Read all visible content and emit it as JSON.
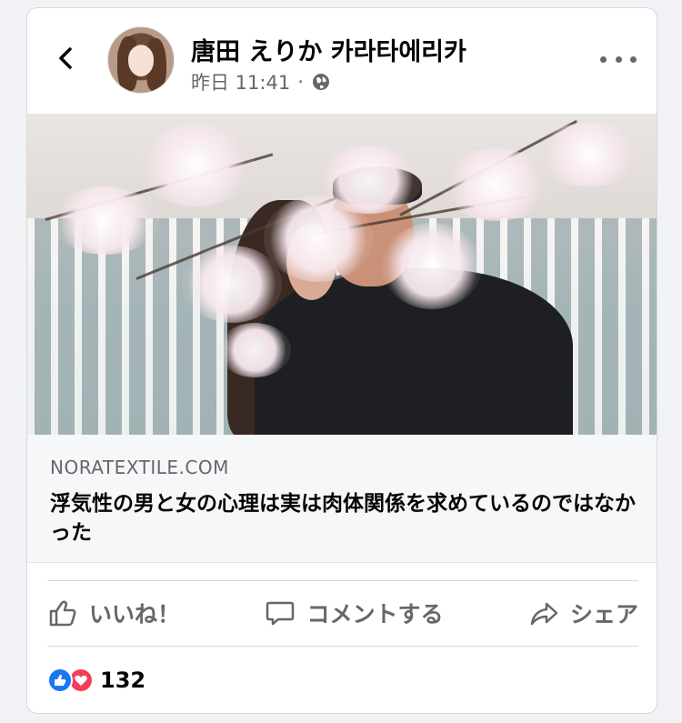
{
  "header": {
    "author": "唐田 えりか 카라타에리카",
    "timestamp": "昨日 11:41",
    "separator": "·",
    "privacy_icon": "globe-icon",
    "back_icon": "chevron-left-icon",
    "more_icon": "more-horizontal-icon"
  },
  "link": {
    "domain": "NORATEXTILE.COM",
    "headline": "浮気性の男と女の心理は実は肉体関係を求めているのではなかった"
  },
  "actions": [
    {
      "label": "いいね！",
      "icon": "thumbs-up-icon"
    },
    {
      "label": "コメントする",
      "icon": "comment-icon"
    },
    {
      "label": "シェア",
      "icon": "share-icon"
    }
  ],
  "reactions": {
    "count": "132",
    "types": [
      "like",
      "love"
    ]
  },
  "colors": {
    "facebook_blue": "#1877f2",
    "love_red": "#f33e58",
    "secondary_text": "#65676b",
    "primary_text": "#050505"
  }
}
